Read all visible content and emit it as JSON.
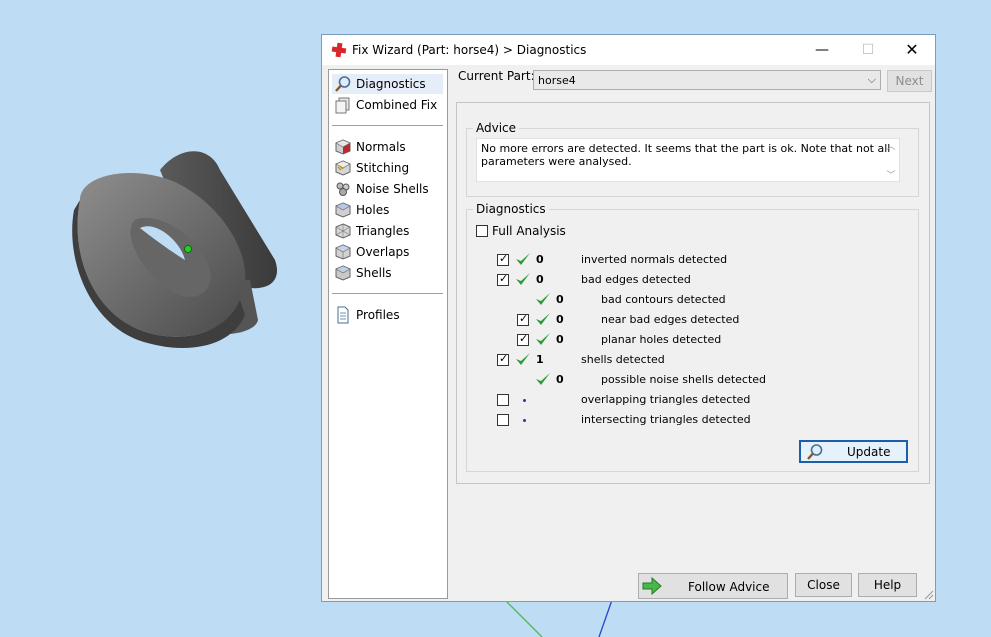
{
  "window": {
    "title": "Fix Wizard (Part: horse4) > Diagnostics",
    "min_glyph": "—",
    "max_glyph": "☐",
    "close_glyph": "✕"
  },
  "nav": {
    "items": [
      {
        "label": "Diagnostics",
        "icon": "magnifier-icon",
        "selected": true
      },
      {
        "label": "Combined Fix",
        "icon": "pages-icon"
      },
      {
        "label": "Normals",
        "icon": "normals-cube-icon"
      },
      {
        "label": "Stitching",
        "icon": "stitching-cube-icon"
      },
      {
        "label": "Noise Shells",
        "icon": "noise-shells-icon"
      },
      {
        "label": "Holes",
        "icon": "holes-cube-icon"
      },
      {
        "label": "Triangles",
        "icon": "triangles-cube-icon"
      },
      {
        "label": "Overlaps",
        "icon": "overlaps-cube-icon"
      },
      {
        "label": "Shells",
        "icon": "shells-cube-icon"
      },
      {
        "label": "Profiles",
        "icon": "document-icon"
      }
    ]
  },
  "current_part": {
    "label": "Current Part:",
    "value": "horse4",
    "next_label": "Next"
  },
  "advice": {
    "title": "Advice",
    "text": "No more errors are detected. It seems that the part is ok. Note that not all parameters were analysed."
  },
  "diagnostics": {
    "title": "Diagnostics",
    "full_analysis_label": "Full Analysis",
    "full_analysis_checked": false,
    "rows": [
      {
        "checkbox": true,
        "checked": true,
        "status": "check",
        "count": "0",
        "label": "inverted normals detected",
        "indent": 0
      },
      {
        "checkbox": true,
        "checked": true,
        "status": "check",
        "count": "0",
        "label": "bad edges detected",
        "indent": 0
      },
      {
        "checkbox": false,
        "checked": false,
        "status": "check",
        "count": "0",
        "label": "bad contours detected",
        "indent": 1
      },
      {
        "checkbox": true,
        "checked": true,
        "status": "check",
        "count": "0",
        "label": "near bad edges detected",
        "indent": 1
      },
      {
        "checkbox": true,
        "checked": true,
        "status": "check",
        "count": "0",
        "label": "planar holes detected",
        "indent": 1
      },
      {
        "checkbox": true,
        "checked": true,
        "status": "check",
        "count": "1",
        "label": "shells detected",
        "indent": 0
      },
      {
        "checkbox": false,
        "checked": false,
        "status": "check",
        "count": "0",
        "label": "possible noise shells detected",
        "indent": 1
      },
      {
        "checkbox": true,
        "checked": false,
        "status": "dot",
        "count": "",
        "label": "overlapping triangles detected",
        "indent": 0
      },
      {
        "checkbox": true,
        "checked": false,
        "status": "dot",
        "count": "",
        "label": "intersecting triangles detected",
        "indent": 0
      }
    ],
    "update_label": "Update"
  },
  "footer": {
    "follow_advice_label": "Follow Advice",
    "close_label": "Close",
    "help_label": "Help"
  },
  "colors": {
    "desktop": "#bfdcf5",
    "check_green": "#2e9a3e",
    "accent_blue": "#1b5fab"
  }
}
